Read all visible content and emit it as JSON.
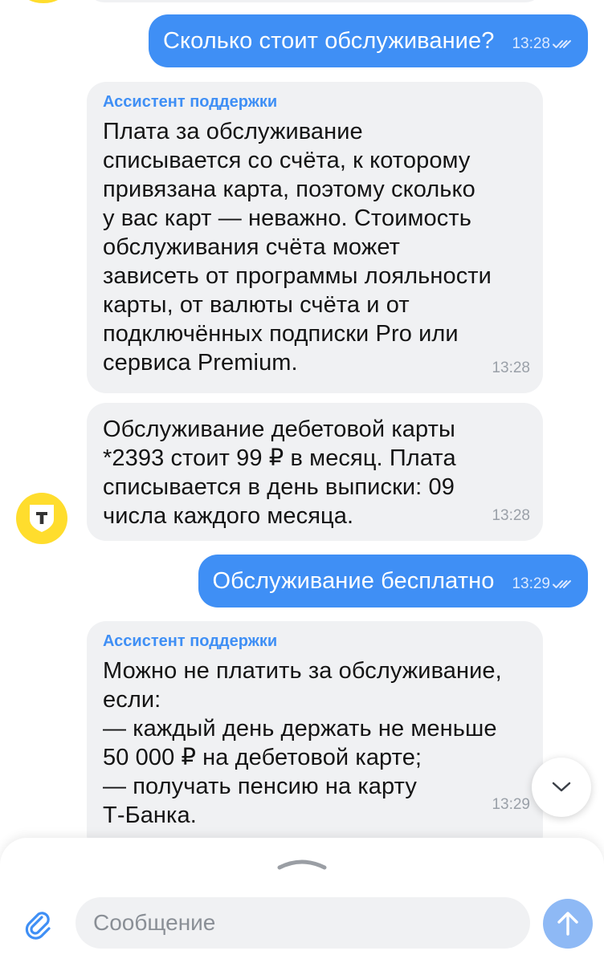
{
  "messages": [
    {
      "direction": "out",
      "text": "Сколько стоит обслуживание?",
      "time": "13:28"
    },
    {
      "direction": "in",
      "sender": "Ассистент поддержки",
      "text": "Плата за обслуживание\nсписывается со счёта, к которому\nпривязана карта, поэтому сколько\nу вас карт — неважно. Стоимость\nобслуживания счёта может\nзависеть от программы лояльности\nкарты, от валюты счёта и от\nподключённых подписки Pro или\nсервиса Premium.",
      "time": "13:28"
    },
    {
      "direction": "in",
      "text": "Обслуживание дебетовой карты\n*2393 стоит 99 ₽ в месяц. Плата\nсписывается в день выписки: 09\nчисла каждого месяца.",
      "time": "13:28"
    },
    {
      "direction": "out",
      "text": "Обслуживание бесплатно",
      "time": "13:29"
    },
    {
      "direction": "in",
      "sender": "Ассистент поддержки",
      "text": "Можно не платить за обслуживание,\nесли:\n— каждый день держать не меньше\n50 000 ₽ на дебетовой карте;\n— получать пенсию на карту\nТ-Банка.",
      "time": "13:29"
    }
  ],
  "avatar": {
    "icon": "t-bank-shield-icon",
    "letter": "Т",
    "color": "#ffdd2d"
  },
  "composer": {
    "placeholder": "Сообщение"
  },
  "icons": {
    "attach": "paperclip-icon",
    "send": "arrow-up-icon",
    "scroll": "chevron-down-icon",
    "read": "double-check-icon"
  },
  "colors": {
    "accent": "#3f8ff5",
    "incoming_bubble": "#f0f1f3",
    "send_button": "#8eb9f5"
  }
}
